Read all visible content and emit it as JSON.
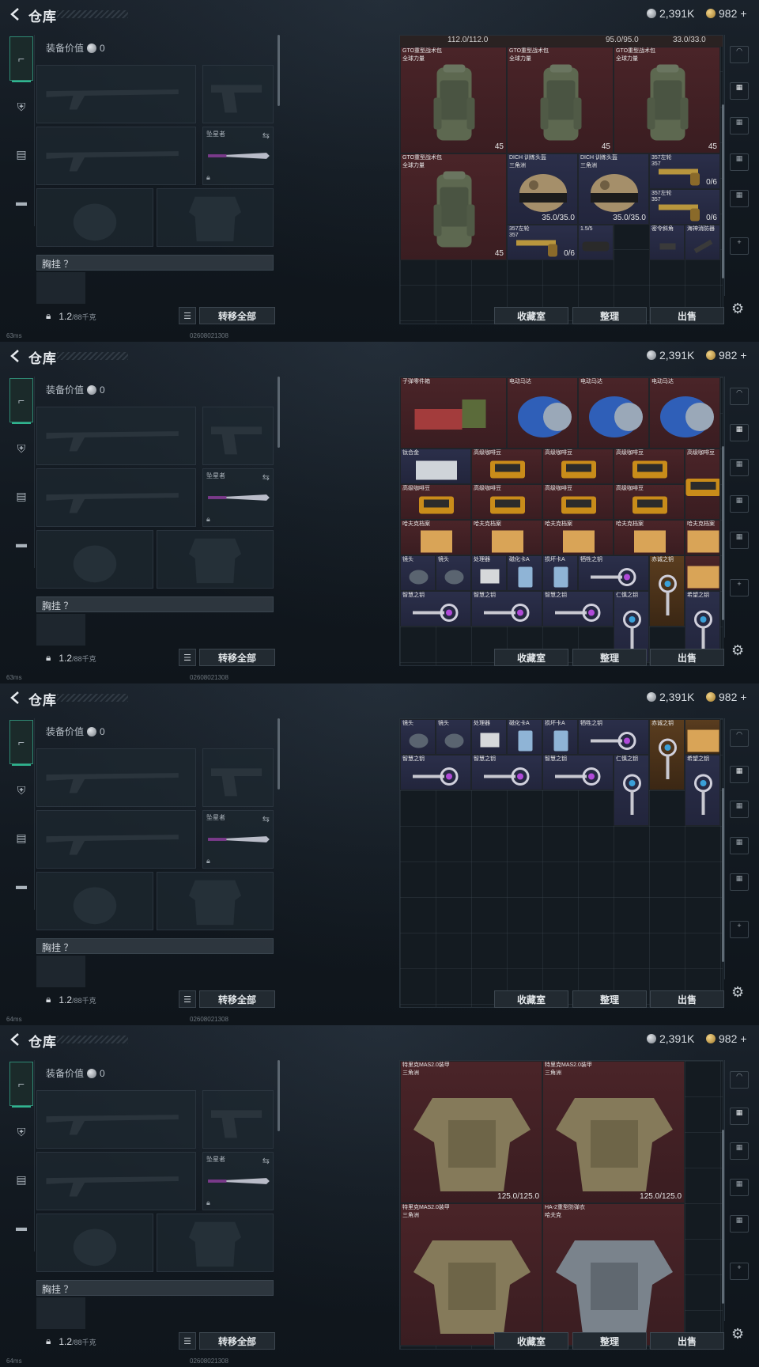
{
  "app": {
    "title": "仓库"
  },
  "currency": {
    "silver": "2,391K",
    "gold": "982",
    "plus": "+"
  },
  "equipment": {
    "value_label": "装备价值",
    "value": "0",
    "knife_label": "坠星者",
    "chest_label": "胸挂 ？",
    "weight": "1.2",
    "weight_max": "/88千克",
    "transfer_all": "转移全部"
  },
  "actions": {
    "vault": "收藏室",
    "sort": "整理",
    "sell": "出售"
  },
  "status": {
    "ping_a": "63ms",
    "ping_b": "64ms",
    "build": "02608021308"
  },
  "panels": [
    {
      "durbar": [
        "112.0/112.0",
        "95.0/95.0",
        "33.0/33.0"
      ],
      "items": [
        {
          "x": 0,
          "y": 0,
          "w": 3,
          "h": 3,
          "c": "red",
          "name": "GTO重型战术包",
          "sub": "全球力量",
          "count": "45",
          "art": "bag"
        },
        {
          "x": 3,
          "y": 0,
          "w": 3,
          "h": 3,
          "c": "red",
          "name": "GTO重型战术包",
          "sub": "全球力量",
          "count": "45",
          "art": "bag"
        },
        {
          "x": 6,
          "y": 0,
          "w": 3,
          "h": 3,
          "c": "red",
          "name": "GTO重型战术包",
          "sub": "全球力量",
          "count": "45",
          "art": "bag"
        },
        {
          "x": 0,
          "y": 3,
          "w": 3,
          "h": 3,
          "c": "red",
          "name": "GTO重型战术包",
          "sub": "全球力量",
          "count": "45",
          "art": "bag"
        },
        {
          "x": 3,
          "y": 3,
          "w": 2,
          "h": 2,
          "c": "blue",
          "name": "DICH 训练头盔",
          "sub": "三角洲",
          "dur": "35.0/35.0",
          "art": "helmet"
        },
        {
          "x": 5,
          "y": 3,
          "w": 2,
          "h": 2,
          "c": "blue",
          "name": "DICH 训练头盔",
          "sub": "三角洲",
          "dur": "35.0/35.0",
          "art": "helmet"
        },
        {
          "x": 7,
          "y": 3,
          "w": 2,
          "h": 1,
          "c": "blue",
          "name": "357左轮",
          "sub": "357",
          "dur": "0/6",
          "art": "gun"
        },
        {
          "x": 7,
          "y": 4,
          "w": 2,
          "h": 1,
          "c": "blue",
          "name": "357左轮",
          "sub": "357",
          "dur": "0/6",
          "art": "gun"
        },
        {
          "x": 3,
          "y": 5,
          "w": 2,
          "h": 1,
          "c": "blue",
          "name": "357左轮",
          "sub": "357",
          "dur": "0/6",
          "art": "gun"
        },
        {
          "x": 5,
          "y": 5,
          "w": 1,
          "h": 1,
          "c": "blue",
          "name": "1.5/5",
          "sub": "",
          "art": "scope"
        },
        {
          "x": 7,
          "y": 5,
          "w": 1,
          "h": 1,
          "c": "blue",
          "name": "密令斜角",
          "sub": "",
          "art": "grip"
        },
        {
          "x": 8,
          "y": 5,
          "w": 1,
          "h": 1,
          "c": "blue",
          "name": "海神消防器",
          "sub": "",
          "art": "tool"
        }
      ]
    },
    {
      "durbar": [],
      "items": [
        {
          "x": 0,
          "y": 0,
          "w": 3,
          "h": 2,
          "c": "red",
          "name": "子弹零件箱",
          "sub": "",
          "art": "box"
        },
        {
          "x": 3,
          "y": 0,
          "w": 2,
          "h": 2,
          "c": "red",
          "name": "电动马达",
          "sub": "",
          "art": "motor"
        },
        {
          "x": 5,
          "y": 0,
          "w": 2,
          "h": 2,
          "c": "red",
          "name": "电动马达",
          "sub": "",
          "art": "motor"
        },
        {
          "x": 7,
          "y": 0,
          "w": 2,
          "h": 2,
          "c": "red",
          "name": "电动马达",
          "sub": "",
          "art": "motor"
        },
        {
          "x": 0,
          "y": 2,
          "w": 2,
          "h": 1,
          "c": "blue",
          "name": "钛合金",
          "sub": "",
          "art": "plate"
        },
        {
          "x": 2,
          "y": 2,
          "w": 2,
          "h": 1,
          "c": "red",
          "name": "高级咖啡豆",
          "sub": "",
          "art": "coffee"
        },
        {
          "x": 4,
          "y": 2,
          "w": 2,
          "h": 1,
          "c": "red",
          "name": "高级咖啡豆",
          "sub": "",
          "art": "coffee"
        },
        {
          "x": 6,
          "y": 2,
          "w": 2,
          "h": 1,
          "c": "red",
          "name": "高级咖啡豆",
          "sub": "",
          "art": "coffee"
        },
        {
          "x": 8,
          "y": 2,
          "w": 1,
          "h": 2,
          "c": "red",
          "name": "高级咖啡豆",
          "sub": "",
          "art": "coffee"
        },
        {
          "x": 0,
          "y": 3,
          "w": 2,
          "h": 1,
          "c": "red",
          "name": "高级咖啡豆",
          "sub": "",
          "art": "coffee"
        },
        {
          "x": 2,
          "y": 3,
          "w": 2,
          "h": 1,
          "c": "red",
          "name": "高级咖啡豆",
          "sub": "",
          "art": "coffee"
        },
        {
          "x": 4,
          "y": 3,
          "w": 2,
          "h": 1,
          "c": "red",
          "name": "高级咖啡豆",
          "sub": "",
          "art": "coffee"
        },
        {
          "x": 6,
          "y": 3,
          "w": 2,
          "h": 1,
          "c": "red",
          "name": "高级咖啡豆",
          "sub": "",
          "art": "coffee"
        },
        {
          "x": 0,
          "y": 4,
          "w": 2,
          "h": 1,
          "c": "red",
          "name": "哈夫克档案",
          "sub": "",
          "art": "file"
        },
        {
          "x": 2,
          "y": 4,
          "w": 2,
          "h": 1,
          "c": "red",
          "name": "哈夫克档案",
          "sub": "",
          "art": "file"
        },
        {
          "x": 4,
          "y": 4,
          "w": 2,
          "h": 1,
          "c": "red",
          "name": "哈夫克档案",
          "sub": "",
          "art": "file"
        },
        {
          "x": 6,
          "y": 4,
          "w": 2,
          "h": 1,
          "c": "red",
          "name": "哈夫克档案",
          "sub": "",
          "art": "file"
        },
        {
          "x": 8,
          "y": 4,
          "w": 1,
          "h": 1,
          "c": "red",
          "name": "哈夫克档案",
          "sub": "",
          "art": "file"
        },
        {
          "x": 0,
          "y": 5,
          "w": 1,
          "h": 1,
          "c": "blue",
          "name": "镜头",
          "sub": "",
          "art": "lens"
        },
        {
          "x": 1,
          "y": 5,
          "w": 1,
          "h": 1,
          "c": "blue",
          "name": "镜头",
          "sub": "",
          "art": "lens"
        },
        {
          "x": 2,
          "y": 5,
          "w": 1,
          "h": 1,
          "c": "blue",
          "name": "处理器",
          "sub": "",
          "art": "chip"
        },
        {
          "x": 3,
          "y": 5,
          "w": 1,
          "h": 1,
          "c": "blue",
          "name": "磁化卡A",
          "sub": "",
          "art": "card"
        },
        {
          "x": 4,
          "y": 5,
          "w": 1,
          "h": 1,
          "c": "blue",
          "name": "损坏卡A",
          "sub": "",
          "art": "card"
        },
        {
          "x": 5,
          "y": 5,
          "w": 2,
          "h": 1,
          "c": "blue",
          "name": "牺牲之钥",
          "sub": "",
          "art": "key"
        },
        {
          "x": 7,
          "y": 5,
          "w": 1,
          "h": 2,
          "c": "gold",
          "name": "赤诚之钥",
          "sub": "",
          "art": "keyv"
        },
        {
          "x": 8,
          "y": 5,
          "w": 1,
          "h": 1,
          "c": "red",
          "name": "",
          "sub": "",
          "art": "file"
        },
        {
          "x": 0,
          "y": 6,
          "w": 2,
          "h": 1,
          "c": "blue",
          "name": "智慧之钥",
          "sub": "",
          "art": "key"
        },
        {
          "x": 2,
          "y": 6,
          "w": 2,
          "h": 1,
          "c": "blue",
          "name": "智慧之钥",
          "sub": "",
          "art": "key"
        },
        {
          "x": 4,
          "y": 6,
          "w": 2,
          "h": 1,
          "c": "blue",
          "name": "智慧之钥",
          "sub": "",
          "art": "key"
        },
        {
          "x": 6,
          "y": 6,
          "w": 1,
          "h": 2,
          "c": "blue",
          "name": "仁慎之钥",
          "sub": "",
          "art": "keyv"
        },
        {
          "x": 8,
          "y": 6,
          "w": 1,
          "h": 2,
          "c": "blue",
          "name": "希望之钥",
          "sub": "",
          "art": "keyv"
        }
      ]
    },
    {
      "durbar": [],
      "items": [
        {
          "x": 0,
          "y": 0,
          "w": 1,
          "h": 1,
          "c": "blue",
          "name": "镜头",
          "sub": "",
          "art": "lens"
        },
        {
          "x": 1,
          "y": 0,
          "w": 1,
          "h": 1,
          "c": "blue",
          "name": "镜头",
          "sub": "",
          "art": "lens"
        },
        {
          "x": 2,
          "y": 0,
          "w": 1,
          "h": 1,
          "c": "blue",
          "name": "处理器",
          "sub": "",
          "art": "chip"
        },
        {
          "x": 3,
          "y": 0,
          "w": 1,
          "h": 1,
          "c": "blue",
          "name": "磁化卡A",
          "sub": "",
          "art": "card"
        },
        {
          "x": 4,
          "y": 0,
          "w": 1,
          "h": 1,
          "c": "blue",
          "name": "损坏卡A",
          "sub": "",
          "art": "card"
        },
        {
          "x": 5,
          "y": 0,
          "w": 2,
          "h": 1,
          "c": "blue",
          "name": "牺牲之钥",
          "sub": "",
          "art": "key"
        },
        {
          "x": 7,
          "y": 0,
          "w": 1,
          "h": 2,
          "c": "gold",
          "name": "赤诚之钥",
          "sub": "",
          "art": "keyv"
        },
        {
          "x": 8,
          "y": 0,
          "w": 1,
          "h": 1,
          "c": "gold",
          "name": "",
          "sub": "",
          "art": "file"
        },
        {
          "x": 0,
          "y": 1,
          "w": 2,
          "h": 1,
          "c": "blue",
          "name": "智慧之钥",
          "sub": "",
          "art": "key"
        },
        {
          "x": 2,
          "y": 1,
          "w": 2,
          "h": 1,
          "c": "blue",
          "name": "智慧之钥",
          "sub": "",
          "art": "key"
        },
        {
          "x": 4,
          "y": 1,
          "w": 2,
          "h": 1,
          "c": "blue",
          "name": "智慧之钥",
          "sub": "",
          "art": "key"
        },
        {
          "x": 6,
          "y": 1,
          "w": 1,
          "h": 2,
          "c": "blue",
          "name": "仁慎之钥",
          "sub": "",
          "art": "keyv"
        },
        {
          "x": 8,
          "y": 1,
          "w": 1,
          "h": 2,
          "c": "blue",
          "name": "希望之钥",
          "sub": "",
          "art": "keyv"
        }
      ]
    },
    {
      "durbar": [],
      "items": [
        {
          "x": 0,
          "y": 0,
          "w": 4,
          "h": 4,
          "c": "red",
          "name": "特里克MAS2.0装甲",
          "sub": "三角洲",
          "dur": "125.0/125.0",
          "art": "vest"
        },
        {
          "x": 4,
          "y": 0,
          "w": 4,
          "h": 4,
          "c": "red",
          "name": "特里克MAS2.0装甲",
          "sub": "三角洲",
          "dur": "125.0/125.0",
          "art": "vest"
        },
        {
          "x": 0,
          "y": 4,
          "w": 4,
          "h": 4,
          "c": "red",
          "name": "特里克MAS2.0装甲",
          "sub": "三角洲",
          "art": "vest"
        },
        {
          "x": 4,
          "y": 4,
          "w": 4,
          "h": 4,
          "c": "red",
          "name": "HA-2重型防弹衣",
          "sub": "哈夫克",
          "art": "vestgray"
        }
      ]
    }
  ]
}
